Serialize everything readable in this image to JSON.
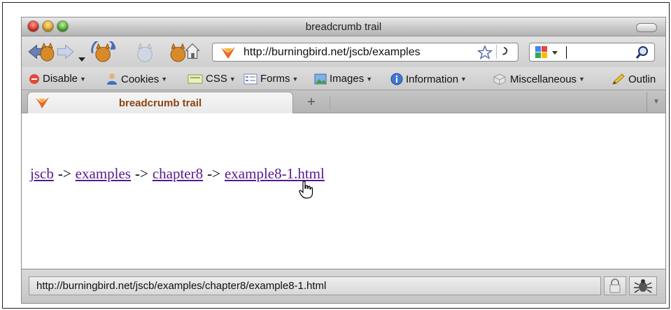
{
  "window": {
    "title": "breadcrumb trail"
  },
  "navbar": {
    "url": "http://burningbird.net/jscb/examples",
    "search_value": ""
  },
  "devbar": {
    "items": [
      {
        "label": "Disable",
        "icon": "disable-icon"
      },
      {
        "label": "Cookies",
        "icon": "cookies-icon"
      },
      {
        "label": "CSS",
        "icon": "css-icon"
      },
      {
        "label": "Forms",
        "icon": "forms-icon"
      },
      {
        "label": "Images",
        "icon": "images-icon"
      },
      {
        "label": "Information",
        "icon": "information-icon"
      },
      {
        "label": "Miscellaneous",
        "icon": "miscellaneous-icon"
      },
      {
        "label": "Outlin",
        "icon": "outline-icon"
      }
    ]
  },
  "tab": {
    "label": "breadcrumb trail",
    "new_tab": "+"
  },
  "breadcrumb": {
    "links": [
      "jscb",
      "examples",
      "chapter8",
      "example8-1.html"
    ],
    "separator": "->"
  },
  "status": {
    "text": "http://burningbird.net/jscb/examples/chapter8/example8-1.html"
  },
  "colors": {
    "visited_link": "#551a8b",
    "tab_text": "#8b4513"
  }
}
